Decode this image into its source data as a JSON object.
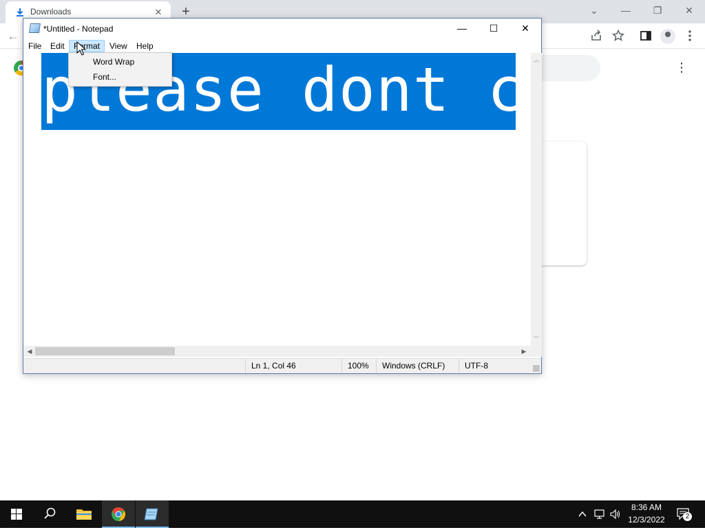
{
  "chrome": {
    "tab_title": "Downloads",
    "tab_close": "✕",
    "new_tab": "+",
    "win_controls": [
      "⌄",
      "—",
      "❐",
      "✕"
    ],
    "back": "←",
    "kebab": "⋮",
    "toolbar_icons": [
      "share-icon",
      "star-icon",
      "side-panel-icon",
      "profile-icon",
      "kebab-menu-icon"
    ]
  },
  "notepad": {
    "title": "*Untitled - Notepad",
    "controls": {
      "minimize": "—",
      "maximize": "☐",
      "close": "✕"
    },
    "menu": [
      "File",
      "Edit",
      "Format",
      "View",
      "Help"
    ],
    "active_menu": "Format",
    "text_visible": "please dont c",
    "format_menu": [
      "Word Wrap",
      "Font..."
    ],
    "status": {
      "position": "Ln 1, Col 46",
      "zoom": "100%",
      "line_ending": "Windows (CRLF)",
      "encoding": "UTF-8"
    },
    "colors": {
      "selection": "#0078d7",
      "menu_highlight": "#cce8ff"
    }
  },
  "taskbar": {
    "apps": [
      "start-icon",
      "search-icon",
      "file-explorer-icon",
      "chrome-icon",
      "notepad-icon"
    ],
    "time": "8:36 AM",
    "date": "12/3/2022",
    "notification_count": "2"
  }
}
